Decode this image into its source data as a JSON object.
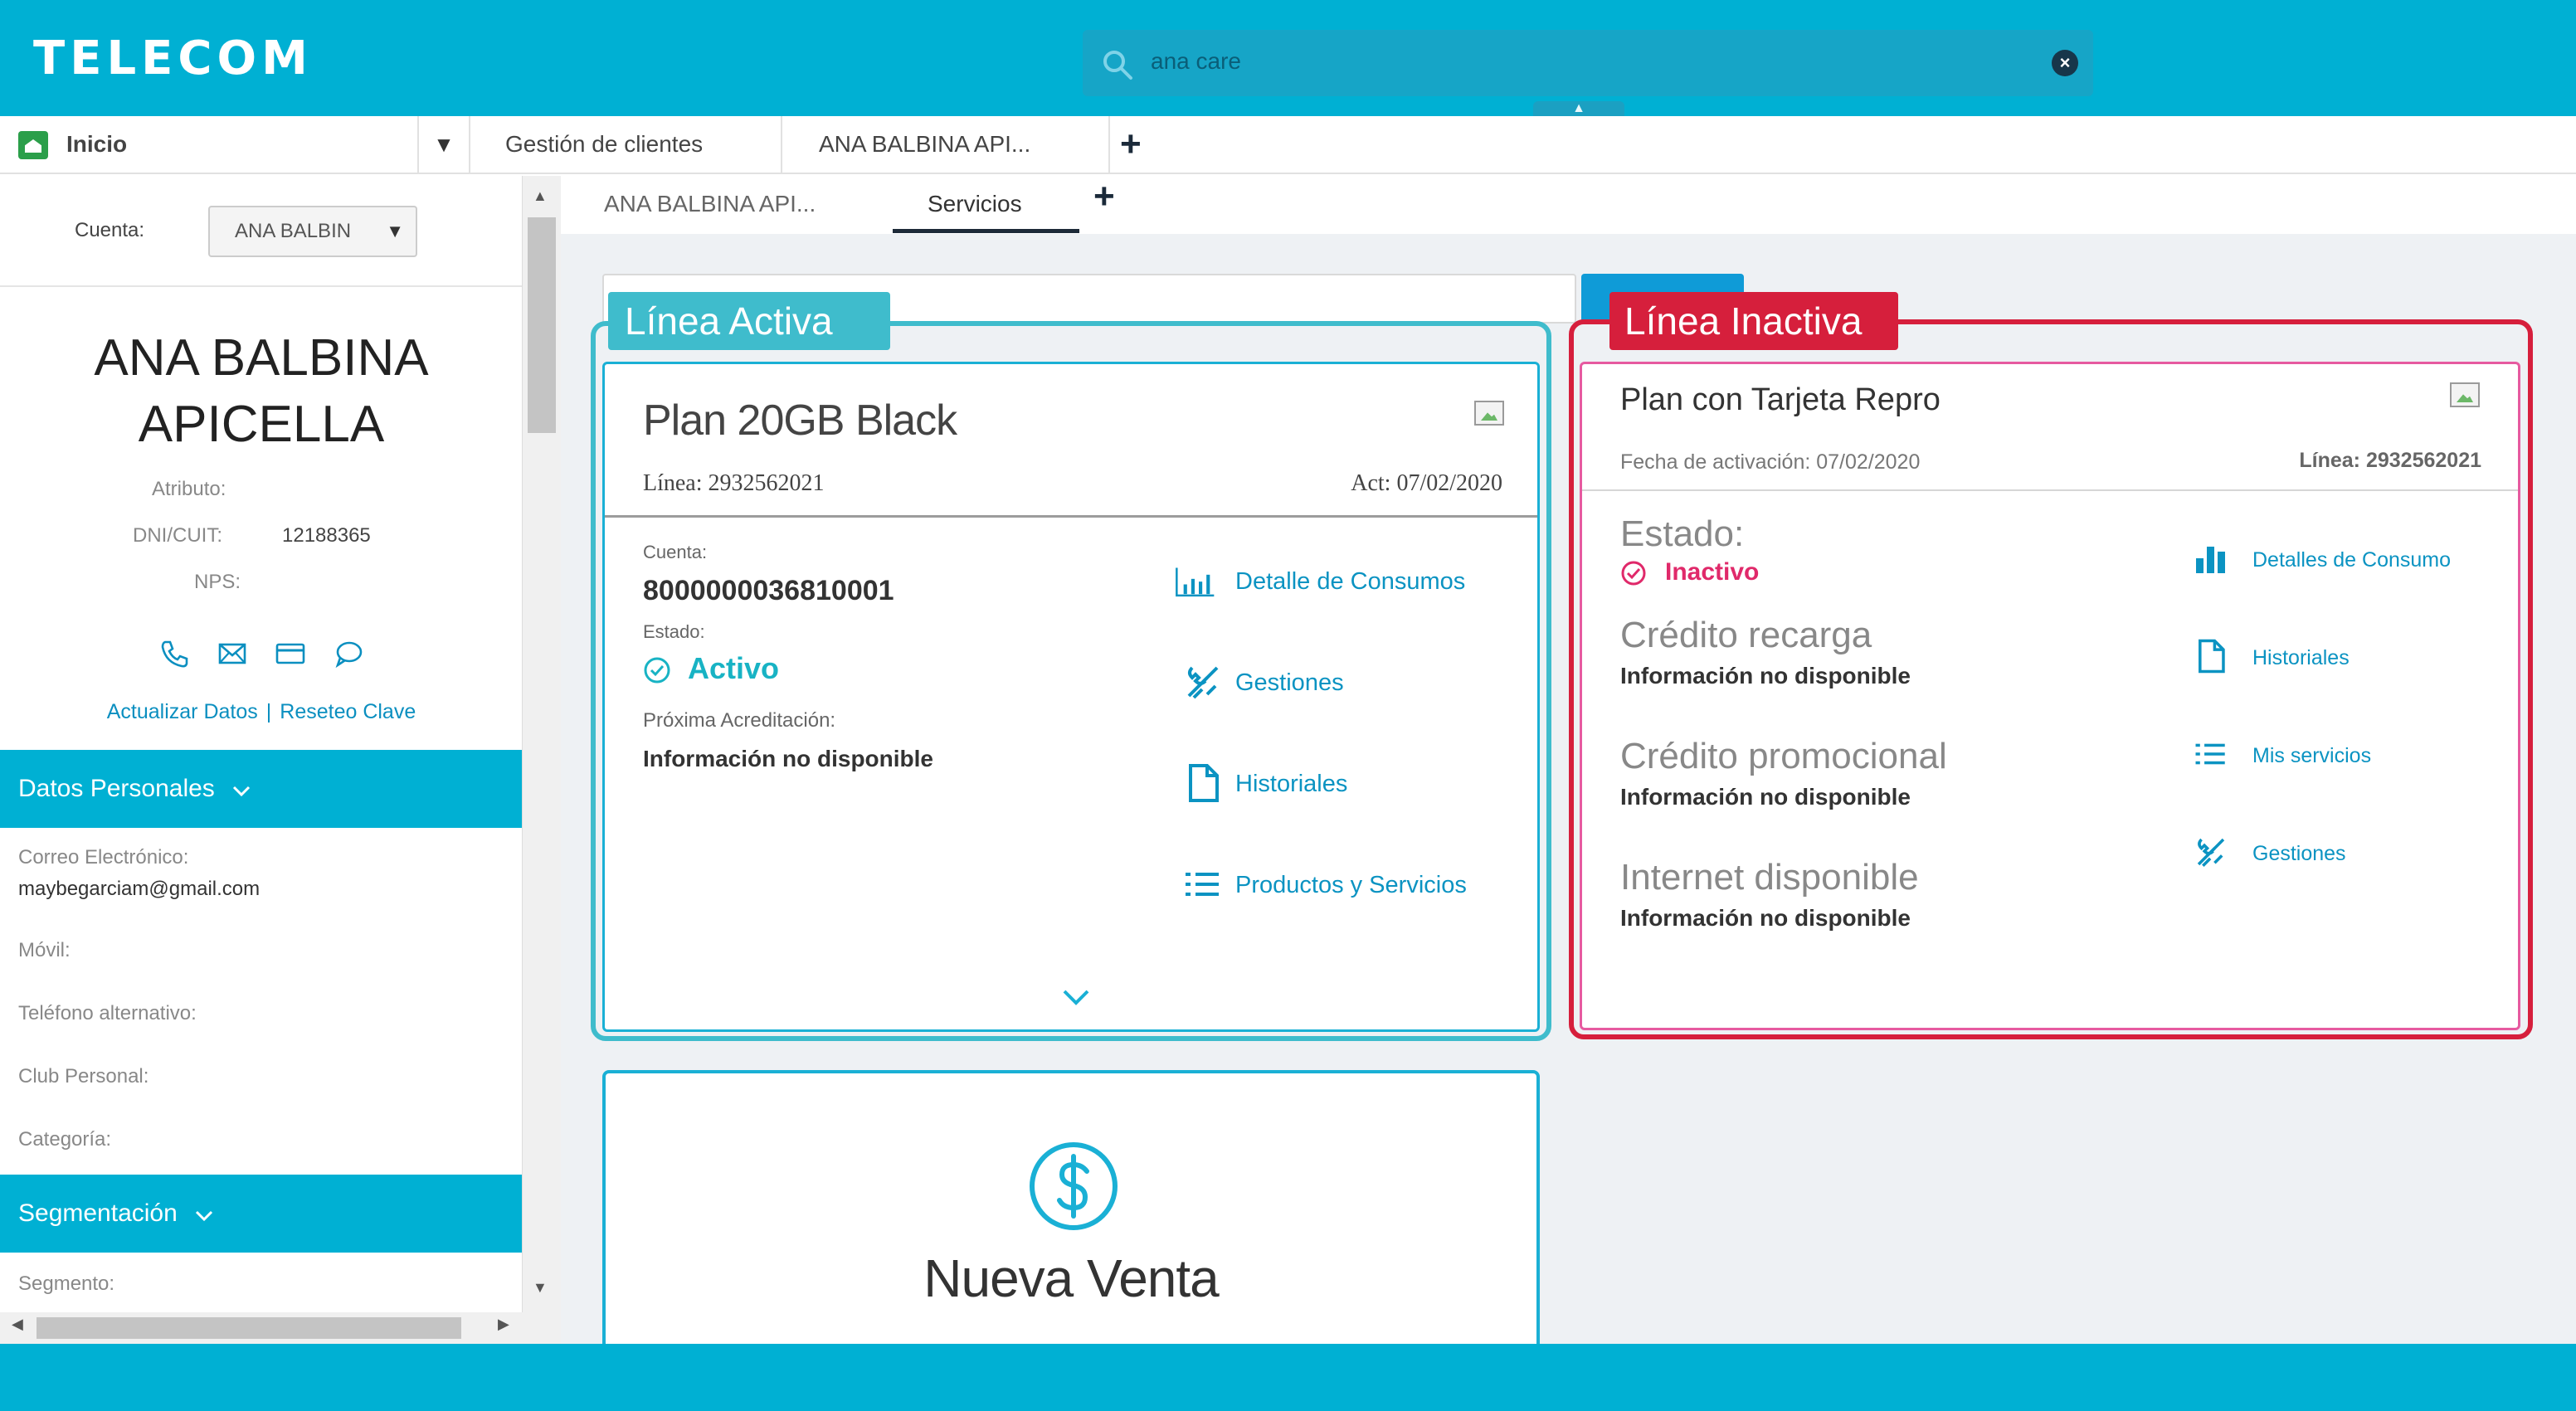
{
  "header": {
    "logo": "TELECOM",
    "search_value": "ana care",
    "clear_symbol": "×",
    "colors": {
      "brand": "#00b0d3"
    }
  },
  "workspace_tabs": [
    {
      "label": "Inicio"
    },
    {
      "label": "Gestión de clientes"
    },
    {
      "label": "ANA BALBINA API..."
    }
  ],
  "add_tab_symbol": "+",
  "dropdown_symbol": "▼",
  "sidebar": {
    "cuenta_label": "Cuenta:",
    "cuenta_value": "ANA BALBIN",
    "name_line1": "ANA BALBINA",
    "name_line2": "APICELLA",
    "atributo_label": "Atributo:",
    "dni_label": "DNI/CUIT:",
    "dni_value": "12188365",
    "nps_label": "NPS:",
    "link_actualizar": "Actualizar Datos",
    "link_separator": "|",
    "link_reseteo": "Reseteo Clave",
    "section_personal": "Datos Personales",
    "fields": [
      {
        "label": "Correo Electrónico:",
        "value": "maybegarciam@gmail.com"
      },
      {
        "label": "Móvil:",
        "value": ""
      },
      {
        "label": "Teléfono alternativo:",
        "value": ""
      },
      {
        "label": "Club Personal:",
        "value": ""
      },
      {
        "label": "Categoría:",
        "value": ""
      }
    ],
    "section_segmentacion": "Segmentación",
    "segmento_label": "Segmento:"
  },
  "subtabs": [
    {
      "label": "ANA BALBINA API..."
    },
    {
      "label": "Servicios"
    }
  ],
  "annotations": {
    "active": "Línea Activa",
    "inactive": "Línea Inactiva",
    "active_color": "#3fbccc",
    "inactive_color": "#d61f3c"
  },
  "active_card": {
    "title": "Plan 20GB Black",
    "linea": "Línea: 2932562021",
    "act": "Act: 07/02/2020",
    "cuenta_label": "Cuenta:",
    "cuenta_value": "8000000036810001",
    "estado_label": "Estado:",
    "estado_value": "Activo",
    "proxima_label": "Próxima Acreditación:",
    "proxima_value": "Información no disponible",
    "actions": [
      {
        "label": "Detalle de Consumos",
        "icon": "bar-chart-icon"
      },
      {
        "label": "Gestiones",
        "icon": "tools-icon"
      },
      {
        "label": "Historiales",
        "icon": "document-icon"
      },
      {
        "label": "Productos y Servicios",
        "icon": "list-icon"
      }
    ]
  },
  "inactive_card": {
    "title": "Plan con Tarjeta Repro",
    "fecha": "Fecha de activación: 07/02/2020",
    "linea": "Línea: 2932562021",
    "estado_label": "Estado:",
    "estado_value": "Inactivo",
    "credito_recarga_label": "Crédito recarga",
    "credito_recarga_value": "Información no disponible",
    "credito_promo_label": "Crédito promocional",
    "credito_promo_value": "Información no disponible",
    "internet_label": "Internet disponible",
    "internet_value": "Información no disponible",
    "actions": [
      {
        "label": "Detalles de Consumo",
        "icon": "bar-chart-icon"
      },
      {
        "label": "Historiales",
        "icon": "document-icon"
      },
      {
        "label": "Mis servicios",
        "icon": "list-icon"
      },
      {
        "label": "Gestiones",
        "icon": "tools-icon"
      }
    ]
  },
  "venta_card": {
    "title": "Nueva Venta",
    "icon": "dollar-icon"
  }
}
